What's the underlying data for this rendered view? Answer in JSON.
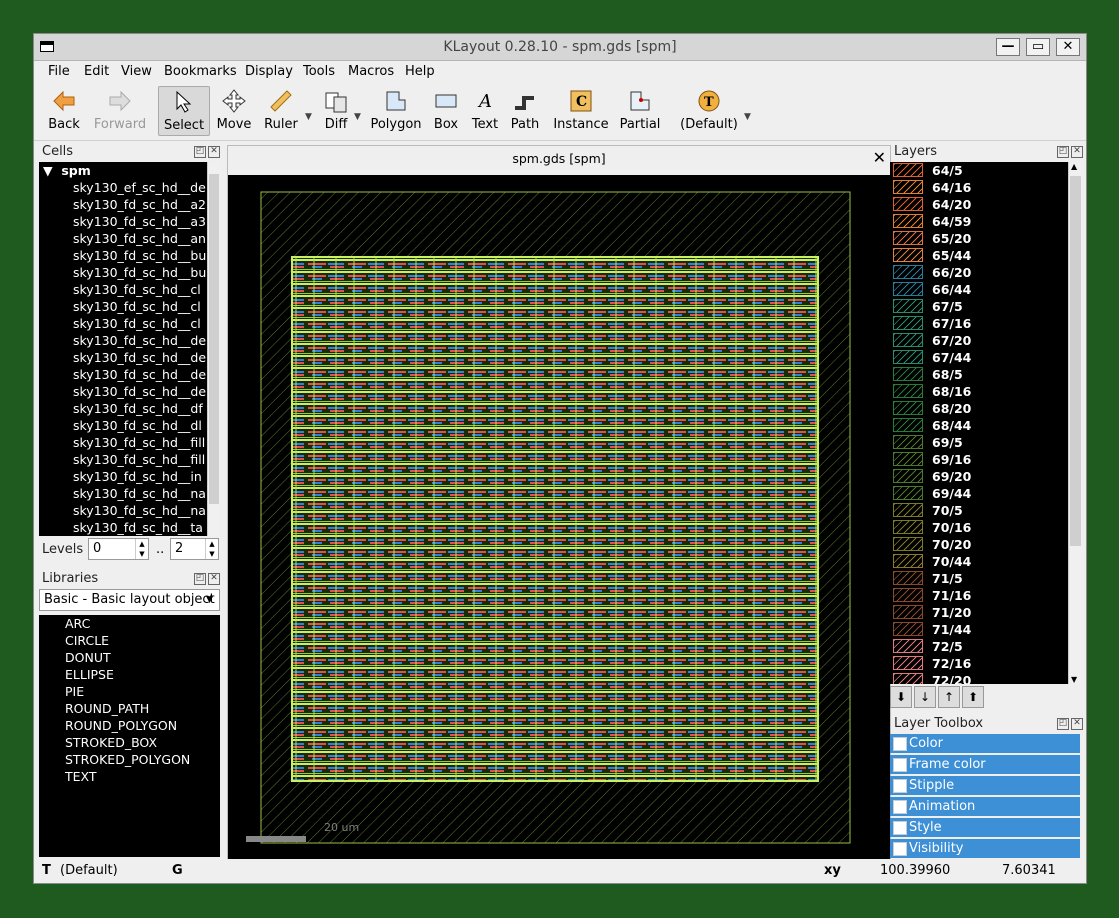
{
  "window": {
    "title": "KLayout 0.28.10 - spm.gds [spm]",
    "buttons": {
      "minimize": "—",
      "maximize": "▭",
      "close": "✕"
    }
  },
  "menu": [
    "File",
    "Edit",
    "View",
    "Bookmarks",
    "Display",
    "Tools",
    "Macros",
    "Help"
  ],
  "toolbar": {
    "back": "Back",
    "forward": "Forward",
    "select": "Select",
    "move": "Move",
    "ruler": "Ruler",
    "diff": "Diff",
    "polygon": "Polygon",
    "box": "Box",
    "text": "Text",
    "path": "Path",
    "instance": "Instance",
    "partial": "Partial",
    "default": "(Default)"
  },
  "cells": {
    "title": "Cells",
    "root": "spm",
    "items": [
      "sky130_ef_sc_hd__de",
      "sky130_fd_sc_hd__a2",
      "sky130_fd_sc_hd__a3",
      "sky130_fd_sc_hd__an",
      "sky130_fd_sc_hd__bu",
      "sky130_fd_sc_hd__bu",
      "sky130_fd_sc_hd__cl",
      "sky130_fd_sc_hd__cl",
      "sky130_fd_sc_hd__cl",
      "sky130_fd_sc_hd__de",
      "sky130_fd_sc_hd__de",
      "sky130_fd_sc_hd__de",
      "sky130_fd_sc_hd__de",
      "sky130_fd_sc_hd__df",
      "sky130_fd_sc_hd__dl",
      "sky130_fd_sc_hd__fill",
      "sky130_fd_sc_hd__fill",
      "sky130_fd_sc_hd__in",
      "sky130_fd_sc_hd__na",
      "sky130_fd_sc_hd__na",
      "sky130_fd_sc_hd__ta"
    ]
  },
  "levels": {
    "label": "Levels",
    "from": "0",
    "sep": "..",
    "to": "2"
  },
  "libraries": {
    "title": "Libraries",
    "selected": "Basic - Basic layout object",
    "items": [
      "ARC",
      "CIRCLE",
      "DONUT",
      "ELLIPSE",
      "PIE",
      "ROUND_PATH",
      "ROUND_POLYGON",
      "STROKED_BOX",
      "STROKED_POLYGON",
      "TEXT"
    ]
  },
  "view": {
    "tab_title": "spm.gds [spm]",
    "scale_label": "20 um"
  },
  "layers": {
    "title": "Layers",
    "items": [
      {
        "name": "64/5",
        "color": "#e06030"
      },
      {
        "name": "64/16",
        "color": "#e08030"
      },
      {
        "name": "64/20",
        "color": "#e06030"
      },
      {
        "name": "64/59",
        "color": "#e08030"
      },
      {
        "name": "65/20",
        "color": "#e07040"
      },
      {
        "name": "65/44",
        "color": "#e08040"
      },
      {
        "name": "66/20",
        "color": "#2a7a9a"
      },
      {
        "name": "66/44",
        "color": "#2a7a9a"
      },
      {
        "name": "67/5",
        "color": "#2a8a6a"
      },
      {
        "name": "67/16",
        "color": "#2a8a6a"
      },
      {
        "name": "67/20",
        "color": "#2a8a6a"
      },
      {
        "name": "67/44",
        "color": "#2a8a6a"
      },
      {
        "name": "68/5",
        "color": "#2a7a3a"
      },
      {
        "name": "68/16",
        "color": "#2a7a3a"
      },
      {
        "name": "68/20",
        "color": "#2a7a3a"
      },
      {
        "name": "68/44",
        "color": "#2a7a3a"
      },
      {
        "name": "69/5",
        "color": "#4a7a2a"
      },
      {
        "name": "69/16",
        "color": "#4a7a2a"
      },
      {
        "name": "69/20",
        "color": "#4a7a2a"
      },
      {
        "name": "69/44",
        "color": "#4a7a2a"
      },
      {
        "name": "70/5",
        "color": "#7a7a2a"
      },
      {
        "name": "70/16",
        "color": "#7a7a2a"
      },
      {
        "name": "70/20",
        "color": "#7a7a2a"
      },
      {
        "name": "70/44",
        "color": "#8a7a2a"
      },
      {
        "name": "71/5",
        "color": "#8a4a2a"
      },
      {
        "name": "71/16",
        "color": "#8a4a2a"
      },
      {
        "name": "71/20",
        "color": "#8a4a2a"
      },
      {
        "name": "71/44",
        "color": "#8a4a2a"
      },
      {
        "name": "72/5",
        "color": "#e07a7a"
      },
      {
        "name": "72/16",
        "color": "#e07a7a"
      },
      {
        "name": "72/20",
        "color": "#e07a7a"
      }
    ]
  },
  "toolbox": {
    "title": "Layer Toolbox",
    "items": [
      "Color",
      "Frame color",
      "Stipple",
      "Animation",
      "Style",
      "Visibility"
    ]
  },
  "status": {
    "mode": "T",
    "default": "(Default)",
    "grid": "G",
    "xy_label": "xy",
    "x": "100.39960",
    "y": "7.60341"
  }
}
